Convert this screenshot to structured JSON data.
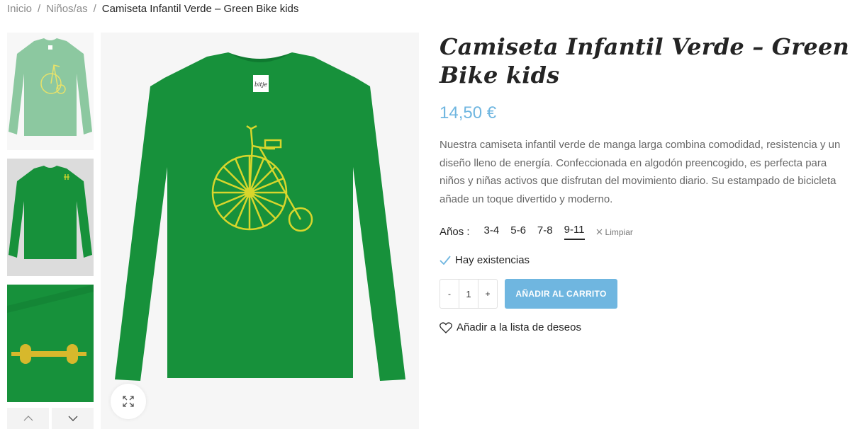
{
  "breadcrumb": {
    "home": "Inicio",
    "category": "Niños/as",
    "current": "Camiseta Infantil Verde – Green Bike kids",
    "separator": "/"
  },
  "product": {
    "title": "Camiseta Infantil Verde – Green Bike kids",
    "price": "14,50 €",
    "description": "Nuestra camiseta infantil verde de manga larga combina comodidad, resistencia y un diseño lleno de energía. Confeccionada en algodón preencogido, es perfecta para niños y niñas activos que disfrutan del movimiento diario. Su estampado de bicicleta añade un toque divertido y moderno.",
    "variation_label": "Años",
    "options": [
      "3-4",
      "5-6",
      "7-8",
      "9-11"
    ],
    "selected_option": "9-11",
    "clear_label": "Limpiar",
    "stock_text": "Hay existencias",
    "quantity": "1",
    "qty_minus": "-",
    "qty_plus": "+",
    "add_to_cart": "AÑADIR AL CARRITO",
    "wishlist": "Añadir a la lista de deseos",
    "label_brand": "bitje"
  },
  "colors": {
    "accent": "#6fb6e0",
    "shirt_green": "#17913b",
    "print_yellow": "#d7d62c",
    "thumb1_green": "#8cc8a0"
  },
  "icons": {
    "zoom": "expand-icon",
    "check": "check-icon",
    "heart": "heart-icon",
    "clear": "close-icon",
    "up": "chevron-up-icon",
    "down": "chevron-down-icon"
  }
}
